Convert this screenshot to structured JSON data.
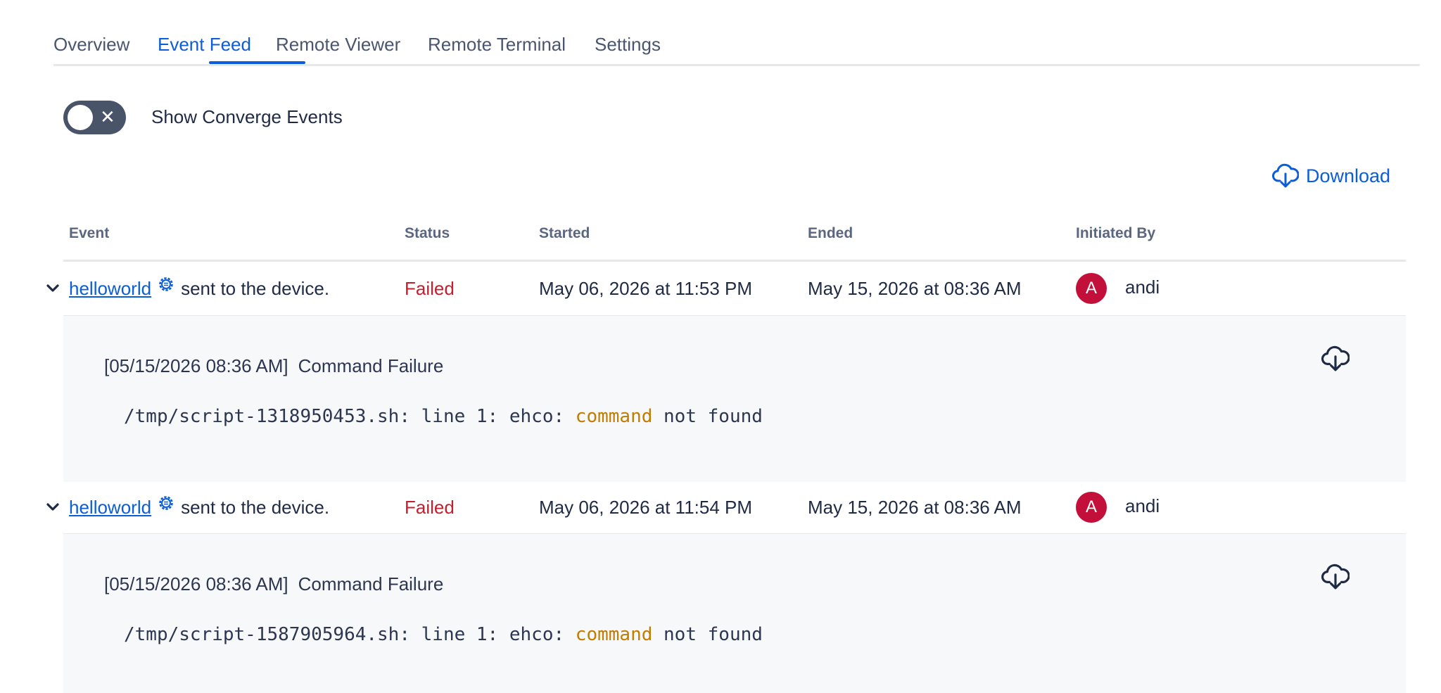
{
  "tabs": [
    {
      "label": "Overview",
      "active": false
    },
    {
      "label": "Event Feed",
      "active": true
    },
    {
      "label": "Remote Viewer",
      "active": false
    },
    {
      "label": "Remote Terminal",
      "active": false
    },
    {
      "label": "Settings",
      "active": false
    }
  ],
  "toggle": {
    "label": "Show Converge Events",
    "state": "off",
    "icon": "close-icon"
  },
  "download": {
    "label": "Download",
    "icon": "cloud-download-icon"
  },
  "table": {
    "headers": [
      "Event",
      "Status",
      "Started",
      "Ended",
      "Initiated By"
    ],
    "rows": [
      {
        "event_link": "helloworld",
        "event_icon": "gear-icon",
        "event_text": "sent to the device.",
        "status": "Failed",
        "started": "May 06, 2026 at 11:53 PM",
        "ended": "May 15, 2026 at 08:36 AM",
        "avatar_initial": "A",
        "user": "andi",
        "detail": {
          "timestamp": "[05/15/2026 08:36 AM]",
          "title": "Command Failure",
          "code_prefix": "/tmp/script-1318950453.sh: line 1: ehco: ",
          "code_keyword": "command",
          "code_suffix": " not found"
        }
      },
      {
        "event_link": "helloworld",
        "event_icon": "gear-icon",
        "event_text": "sent to the device.",
        "status": "Failed",
        "started": "May 06, 2026 at 11:54 PM",
        "ended": "May 15, 2026 at 08:36 AM",
        "avatar_initial": "A",
        "user": "andi",
        "detail": {
          "timestamp": "[05/15/2026 08:36 AM]",
          "title": "Command Failure",
          "code_prefix": "/tmp/script-1587905964.sh: line 1: ehco: ",
          "code_keyword": "command",
          "code_suffix": " not found"
        }
      }
    ]
  },
  "colors": {
    "accent": "#0b5ed7",
    "failed": "#c21f2f",
    "avatar": "#c2103b",
    "code_keyword": "#c27c00",
    "detail_bg": "#f7f8fa"
  }
}
